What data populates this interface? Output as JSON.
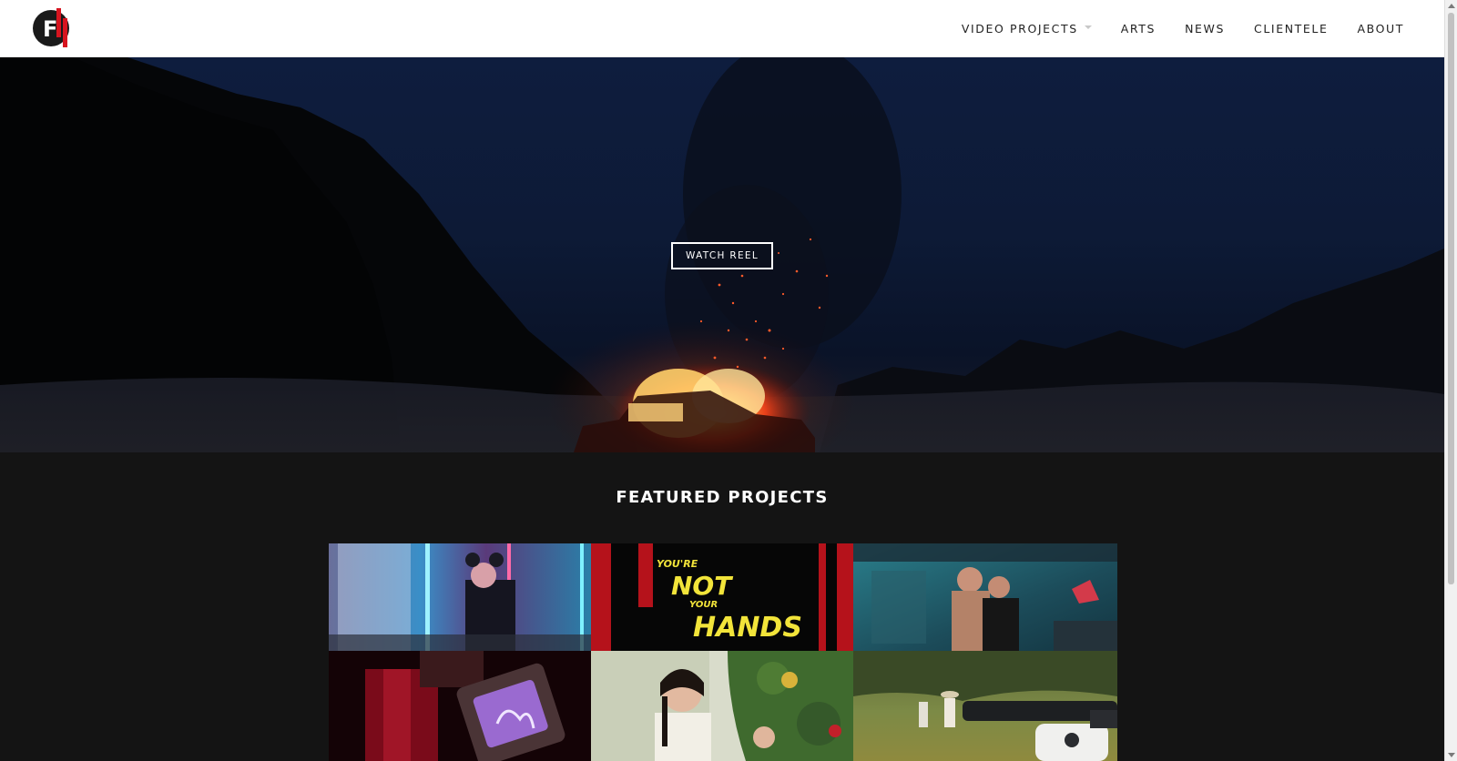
{
  "header": {
    "logo_text": "F",
    "nav": [
      {
        "label": "VIDEO PROJECTS",
        "has_dropdown": true
      },
      {
        "label": "ARTS"
      },
      {
        "label": "NEWS"
      },
      {
        "label": "CLIENTELE"
      },
      {
        "label": "ABOUT"
      }
    ]
  },
  "hero": {
    "button_label": "WATCH REEL"
  },
  "featured": {
    "title": "FEATURED PROJECTS",
    "tile_texts": {
      "line1": "YOU'RE",
      "line2": "NOT",
      "line3": "YOUR",
      "line4": "HANDS"
    }
  },
  "colors": {
    "header_bg": "#ffffff",
    "page_bg": "#141414",
    "nav_text": "#222222",
    "logo_red": "#d7141f"
  }
}
